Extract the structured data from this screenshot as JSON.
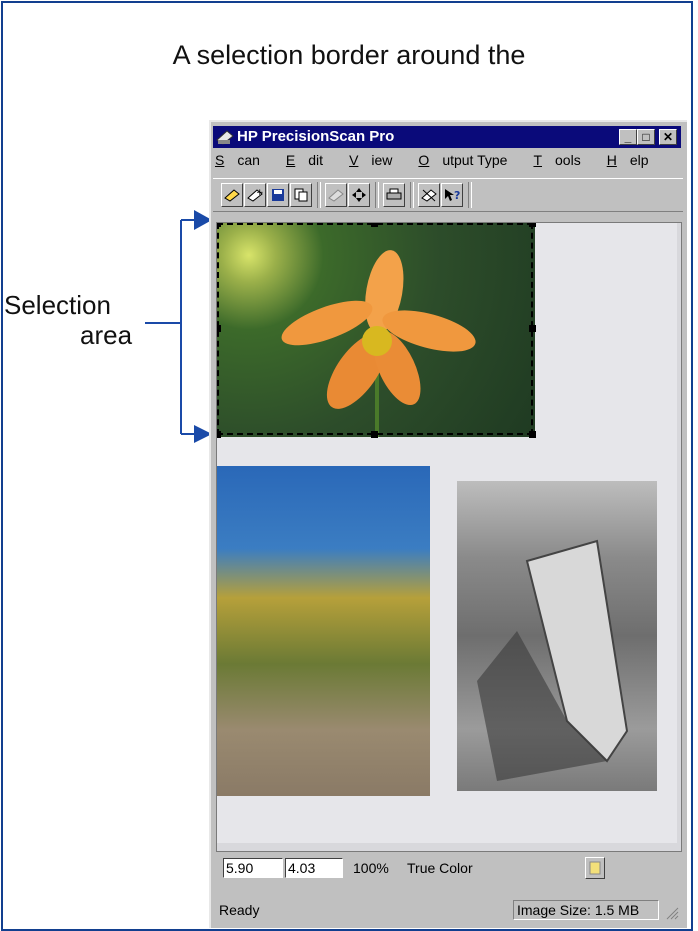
{
  "caption": "A selection border around the",
  "annotation": {
    "line1": "Selection",
    "line2": "area"
  },
  "window": {
    "title": "HP PrecisionScan Pro",
    "controls": {
      "minimize": "_",
      "maximize": "□",
      "close": "✕"
    },
    "menu": [
      {
        "label": "Scan",
        "accel": "S",
        "rest": "can"
      },
      {
        "label": "Edit",
        "accel": "E",
        "rest": "dit"
      },
      {
        "label": "View",
        "accel": "V",
        "rest": "iew"
      },
      {
        "label": "Output Type",
        "accel": "O",
        "rest": "utput Type"
      },
      {
        "label": "Tools",
        "accel": "T",
        "rest": "ools"
      },
      {
        "label": "Help",
        "accel": "H",
        "rest": "elp"
      }
    ],
    "toolbar_icons": [
      "scan-icon",
      "add-scan-icon",
      "save-icon",
      "copy-icon",
      "print-preview-icon",
      "move-icon",
      "printer-icon",
      "tools-icon",
      "help-pointer-icon"
    ]
  },
  "statusrow": {
    "width": "5.90",
    "height": "4.03",
    "zoom": "100%",
    "mode": "True Color"
  },
  "statusbar": {
    "status": "Ready",
    "image_size": "Image Size: 1.5 MB"
  },
  "colors": {
    "frame": "#123f8f",
    "arrow": "#1a4aa8",
    "titlebar": "#0a0a7a"
  }
}
